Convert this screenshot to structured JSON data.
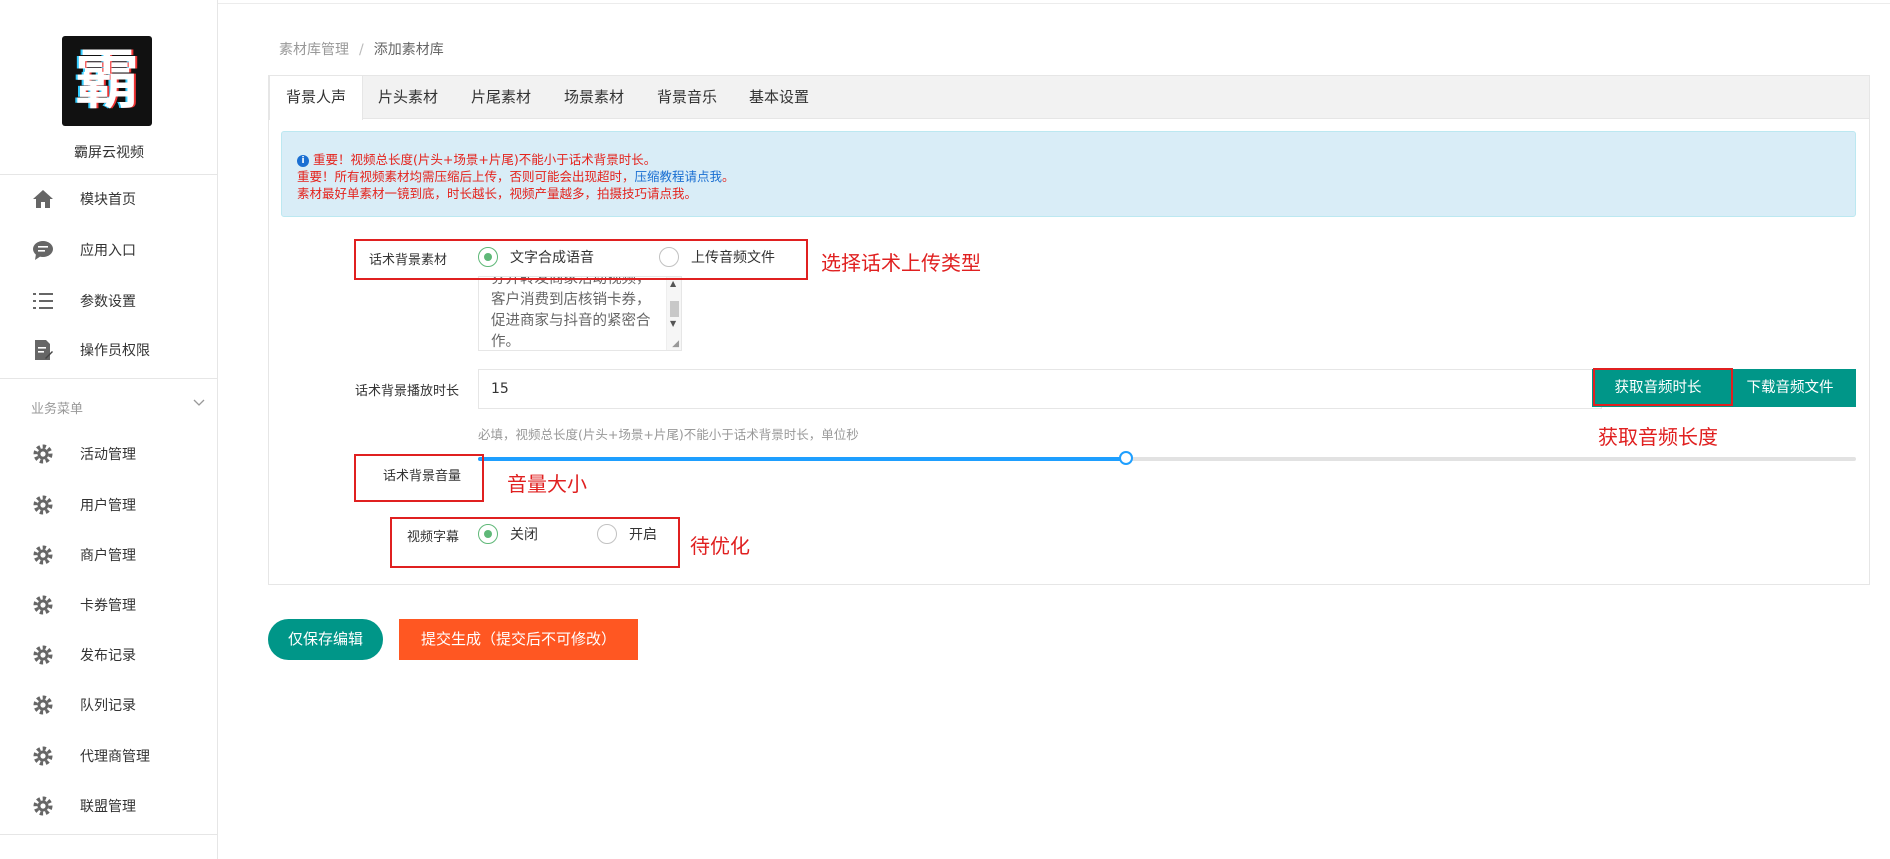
{
  "sidebar": {
    "logo_glyph": "霸",
    "brand": "霸屏云视频",
    "items_top": [
      {
        "label": "模块首页",
        "icon": "home-icon"
      },
      {
        "label": "应用入口",
        "icon": "chat-bubble-icon"
      },
      {
        "label": "参数设置",
        "icon": "list-icon"
      },
      {
        "label": "操作员权限",
        "icon": "document-edit-icon"
      }
    ],
    "section_title": "业务菜单",
    "items_business": [
      {
        "label": "活动管理",
        "icon": "gear-icon"
      },
      {
        "label": "用户管理",
        "icon": "gear-icon"
      },
      {
        "label": "商户管理",
        "icon": "gear-icon"
      },
      {
        "label": "卡券管理",
        "icon": "gear-icon"
      },
      {
        "label": "发布记录",
        "icon": "gear-icon"
      },
      {
        "label": "队列记录",
        "icon": "gear-icon"
      },
      {
        "label": "代理商管理",
        "icon": "gear-icon"
      },
      {
        "label": "联盟管理",
        "icon": "gear-icon"
      }
    ]
  },
  "breadcrumb": {
    "parent": "素材库管理",
    "separator": "/",
    "current": "添加素材库"
  },
  "tabs": [
    {
      "label": "背景人声",
      "active": true
    },
    {
      "label": "片头素材",
      "active": false
    },
    {
      "label": "片尾素材",
      "active": false
    },
    {
      "label": "场景素材",
      "active": false
    },
    {
      "label": "背景音乐",
      "active": false
    },
    {
      "label": "基本设置",
      "active": false
    }
  ],
  "alert": {
    "info_glyph": "i",
    "line1": "重要！视频总长度(片头+场景+片尾)不能小于话术背景时长。",
    "line2_text": "重要！所有视频素材均需压缩后上传，否则可能会出现超时，",
    "line2_link": "压缩教程请点我",
    "line2_end": "。",
    "line3": "素材最好单素材一镜到底，时长越长，视频产量越多，拍摄技巧请点我。"
  },
  "form": {
    "material_label": "话术背景素材",
    "material_options": [
      {
        "label": "文字合成语音",
        "checked": true
      },
      {
        "label": "上传音频文件",
        "checked": false
      }
    ],
    "script_text": "券并转发商家活动视频，客户消费到店核销卡券，促进商家与抖音的紧密合作。",
    "duration_label": "话术背景播放时长",
    "duration_value": "15",
    "get_duration_button": "获取音频时长",
    "download_button": "下载音频文件",
    "duration_hint": "必填，视频总长度(片头+场景+片尾)不能小于话术背景时长，单位秒",
    "volume_label": "话术背景音量",
    "volume_percent": 47,
    "subtitle_label": "视频字幕",
    "subtitle_options": [
      {
        "label": "关闭",
        "checked": true
      },
      {
        "label": "开启",
        "checked": false
      }
    ]
  },
  "annotations": {
    "upload_type": "选择话术上传类型",
    "get_length": "获取音频长度",
    "volume": "音量大小",
    "todo": "待优化"
  },
  "actions": {
    "save": "仅保存编辑",
    "submit": "提交生成（提交后不可修改）"
  },
  "colors": {
    "primary": "#009688",
    "danger": "#ff5722",
    "annotation": "#e02020",
    "slider": "#1e9fff"
  }
}
